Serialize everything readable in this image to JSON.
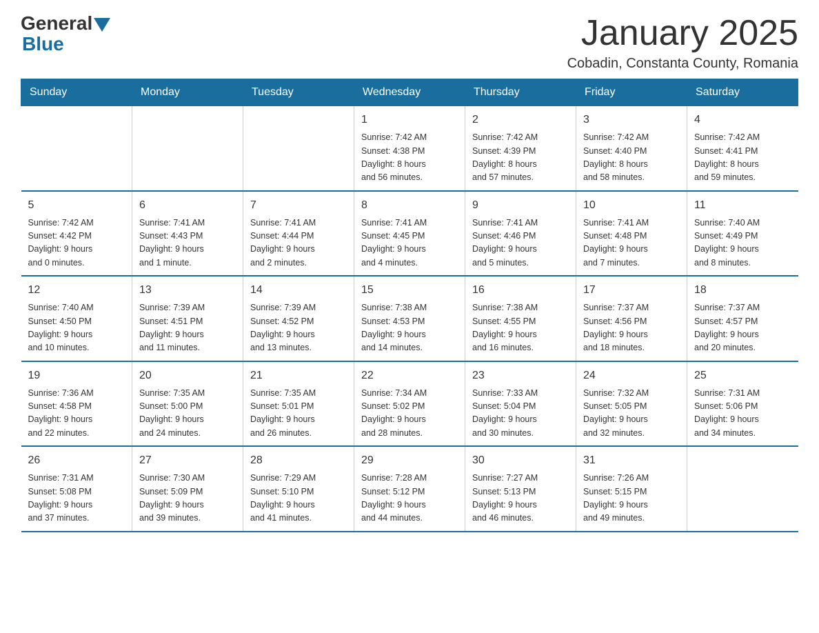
{
  "header": {
    "logo_general": "General",
    "logo_blue": "Blue",
    "title": "January 2025",
    "subtitle": "Cobadin, Constanta County, Romania"
  },
  "days_of_week": [
    "Sunday",
    "Monday",
    "Tuesday",
    "Wednesday",
    "Thursday",
    "Friday",
    "Saturday"
  ],
  "weeks": [
    [
      {
        "day": "",
        "info": ""
      },
      {
        "day": "",
        "info": ""
      },
      {
        "day": "",
        "info": ""
      },
      {
        "day": "1",
        "info": "Sunrise: 7:42 AM\nSunset: 4:38 PM\nDaylight: 8 hours\nand 56 minutes."
      },
      {
        "day": "2",
        "info": "Sunrise: 7:42 AM\nSunset: 4:39 PM\nDaylight: 8 hours\nand 57 minutes."
      },
      {
        "day": "3",
        "info": "Sunrise: 7:42 AM\nSunset: 4:40 PM\nDaylight: 8 hours\nand 58 minutes."
      },
      {
        "day": "4",
        "info": "Sunrise: 7:42 AM\nSunset: 4:41 PM\nDaylight: 8 hours\nand 59 minutes."
      }
    ],
    [
      {
        "day": "5",
        "info": "Sunrise: 7:42 AM\nSunset: 4:42 PM\nDaylight: 9 hours\nand 0 minutes."
      },
      {
        "day": "6",
        "info": "Sunrise: 7:41 AM\nSunset: 4:43 PM\nDaylight: 9 hours\nand 1 minute."
      },
      {
        "day": "7",
        "info": "Sunrise: 7:41 AM\nSunset: 4:44 PM\nDaylight: 9 hours\nand 2 minutes."
      },
      {
        "day": "8",
        "info": "Sunrise: 7:41 AM\nSunset: 4:45 PM\nDaylight: 9 hours\nand 4 minutes."
      },
      {
        "day": "9",
        "info": "Sunrise: 7:41 AM\nSunset: 4:46 PM\nDaylight: 9 hours\nand 5 minutes."
      },
      {
        "day": "10",
        "info": "Sunrise: 7:41 AM\nSunset: 4:48 PM\nDaylight: 9 hours\nand 7 minutes."
      },
      {
        "day": "11",
        "info": "Sunrise: 7:40 AM\nSunset: 4:49 PM\nDaylight: 9 hours\nand 8 minutes."
      }
    ],
    [
      {
        "day": "12",
        "info": "Sunrise: 7:40 AM\nSunset: 4:50 PM\nDaylight: 9 hours\nand 10 minutes."
      },
      {
        "day": "13",
        "info": "Sunrise: 7:39 AM\nSunset: 4:51 PM\nDaylight: 9 hours\nand 11 minutes."
      },
      {
        "day": "14",
        "info": "Sunrise: 7:39 AM\nSunset: 4:52 PM\nDaylight: 9 hours\nand 13 minutes."
      },
      {
        "day": "15",
        "info": "Sunrise: 7:38 AM\nSunset: 4:53 PM\nDaylight: 9 hours\nand 14 minutes."
      },
      {
        "day": "16",
        "info": "Sunrise: 7:38 AM\nSunset: 4:55 PM\nDaylight: 9 hours\nand 16 minutes."
      },
      {
        "day": "17",
        "info": "Sunrise: 7:37 AM\nSunset: 4:56 PM\nDaylight: 9 hours\nand 18 minutes."
      },
      {
        "day": "18",
        "info": "Sunrise: 7:37 AM\nSunset: 4:57 PM\nDaylight: 9 hours\nand 20 minutes."
      }
    ],
    [
      {
        "day": "19",
        "info": "Sunrise: 7:36 AM\nSunset: 4:58 PM\nDaylight: 9 hours\nand 22 minutes."
      },
      {
        "day": "20",
        "info": "Sunrise: 7:35 AM\nSunset: 5:00 PM\nDaylight: 9 hours\nand 24 minutes."
      },
      {
        "day": "21",
        "info": "Sunrise: 7:35 AM\nSunset: 5:01 PM\nDaylight: 9 hours\nand 26 minutes."
      },
      {
        "day": "22",
        "info": "Sunrise: 7:34 AM\nSunset: 5:02 PM\nDaylight: 9 hours\nand 28 minutes."
      },
      {
        "day": "23",
        "info": "Sunrise: 7:33 AM\nSunset: 5:04 PM\nDaylight: 9 hours\nand 30 minutes."
      },
      {
        "day": "24",
        "info": "Sunrise: 7:32 AM\nSunset: 5:05 PM\nDaylight: 9 hours\nand 32 minutes."
      },
      {
        "day": "25",
        "info": "Sunrise: 7:31 AM\nSunset: 5:06 PM\nDaylight: 9 hours\nand 34 minutes."
      }
    ],
    [
      {
        "day": "26",
        "info": "Sunrise: 7:31 AM\nSunset: 5:08 PM\nDaylight: 9 hours\nand 37 minutes."
      },
      {
        "day": "27",
        "info": "Sunrise: 7:30 AM\nSunset: 5:09 PM\nDaylight: 9 hours\nand 39 minutes."
      },
      {
        "day": "28",
        "info": "Sunrise: 7:29 AM\nSunset: 5:10 PM\nDaylight: 9 hours\nand 41 minutes."
      },
      {
        "day": "29",
        "info": "Sunrise: 7:28 AM\nSunset: 5:12 PM\nDaylight: 9 hours\nand 44 minutes."
      },
      {
        "day": "30",
        "info": "Sunrise: 7:27 AM\nSunset: 5:13 PM\nDaylight: 9 hours\nand 46 minutes."
      },
      {
        "day": "31",
        "info": "Sunrise: 7:26 AM\nSunset: 5:15 PM\nDaylight: 9 hours\nand 49 minutes."
      },
      {
        "day": "",
        "info": ""
      }
    ]
  ]
}
